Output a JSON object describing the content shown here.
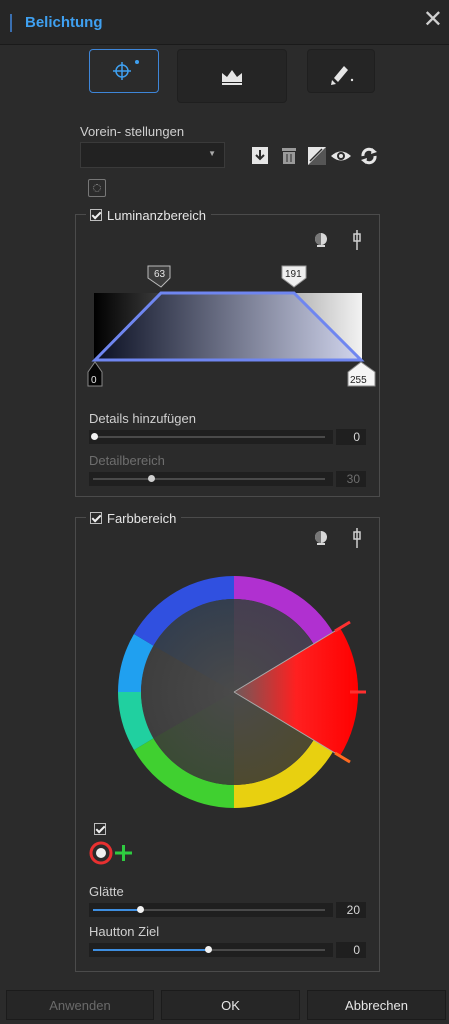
{
  "window": {
    "title": "Belichtung"
  },
  "presets": {
    "label": "Vorein- stellungen",
    "value": ""
  },
  "luminance": {
    "title": "Luminanzbereich",
    "checked": true,
    "handles": {
      "low": "0",
      "mid_low": "63",
      "mid_high": "191",
      "high": "255"
    },
    "details_label": "Details hinzufügen",
    "details_value": "0",
    "details_level": 0.0,
    "range_label": "Detailbereich",
    "range_value": "30",
    "range_level": 0.25
  },
  "color": {
    "title": "Farbbereich",
    "checked": true,
    "skin_checked": true,
    "smooth_label": "Glätte",
    "smooth_value": "20",
    "smooth_level": 0.2,
    "target_label": "Hautton Ziel",
    "target_value": "0",
    "target_level": 0.5
  },
  "footer": {
    "apply": "Anwenden",
    "ok": "OK",
    "cancel": "Abbrechen"
  },
  "colors": {
    "accent": "#3fa0f0",
    "selection": "#e83030",
    "add": "#2ecc40"
  }
}
